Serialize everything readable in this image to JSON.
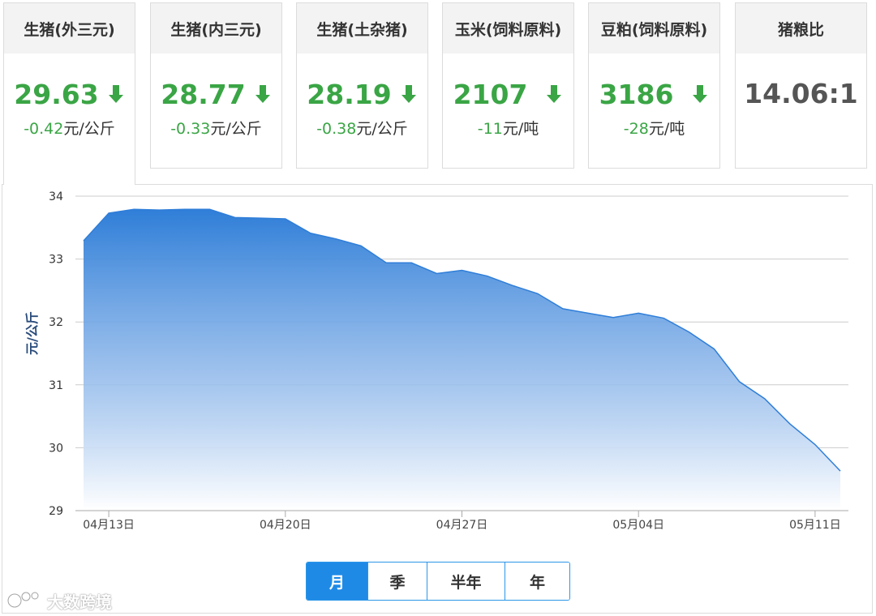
{
  "cards": [
    {
      "title": "生猪(外三元)",
      "price": "29.63",
      "change": "-0.42",
      "unit": "元/公斤",
      "trend": "down",
      "active": true
    },
    {
      "title": "生猪(内三元)",
      "price": "28.77",
      "change": "-0.33",
      "unit": "元/公斤",
      "trend": "down",
      "active": false
    },
    {
      "title": "生猪(土杂猪)",
      "price": "28.19",
      "change": "-0.38",
      "unit": "元/公斤",
      "trend": "down",
      "active": false
    },
    {
      "title": "玉米(饲料原料)",
      "price": "2107",
      "change": "-11",
      "unit": "元/吨",
      "trend": "down",
      "active": false
    },
    {
      "title": "豆粕(饲料原料)",
      "price": "3186",
      "change": "-28",
      "unit": "元/吨",
      "trend": "down",
      "active": false
    }
  ],
  "ratio_card": {
    "title": "猪粮比",
    "value": "14.06:1"
  },
  "colors": {
    "accent": "#1f8ae6",
    "down": "#3aa545",
    "area_top": "#2f7ed8",
    "line": "#2f7ed8"
  },
  "chart_data": {
    "type": "area",
    "ylabel": "元/公斤",
    "ylim": [
      29,
      34
    ],
    "yticks": [
      29,
      30,
      31,
      32,
      33,
      34
    ],
    "xlim": [
      "04月12日",
      "05月12日"
    ],
    "xticks": [
      "04月13日",
      "04月20日",
      "04月27日",
      "05月04日",
      "05月11日"
    ],
    "grid": true,
    "series": [
      {
        "x": [
          "04月12日",
          "04月13日",
          "04月14日",
          "04月15日",
          "04月16日",
          "04月17日",
          "04月18日",
          "04月19日",
          "04月20日",
          "04月21日",
          "04月22日",
          "04月23日",
          "04月24日",
          "04月25日",
          "04月26日",
          "04月27日",
          "04月28日",
          "04月29日",
          "04月30日",
          "05月01日",
          "05月02日",
          "05月03日",
          "05月04日",
          "05月05日",
          "05月06日",
          "05月07日",
          "05月08日",
          "05月09日",
          "05月10日",
          "05月11日",
          "05月12日"
        ],
        "values": [
          33.29,
          33.73,
          33.79,
          33.78,
          33.79,
          33.79,
          33.66,
          33.65,
          33.64,
          33.41,
          33.32,
          33.21,
          32.94,
          32.94,
          32.77,
          32.82,
          32.73,
          32.58,
          32.45,
          32.21,
          32.14,
          32.07,
          32.14,
          32.06,
          31.84,
          31.57,
          31.05,
          30.78,
          30.38,
          30.05,
          29.63
        ]
      }
    ]
  },
  "period_buttons": [
    {
      "label": "月",
      "active": true
    },
    {
      "label": "季",
      "active": false
    },
    {
      "label": "半年",
      "active": false
    },
    {
      "label": "年",
      "active": false
    }
  ],
  "watermark": {
    "text": "大数跨境",
    "icon": "logo-icon"
  }
}
